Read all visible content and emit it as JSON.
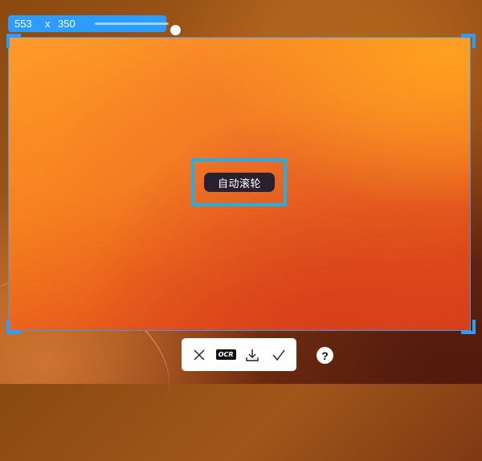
{
  "size_indicator": {
    "width": "553",
    "separator": "x",
    "height": "350"
  },
  "capture_region": {
    "auto_scroll_label": "自动滚轮"
  },
  "toolbar": {
    "ocr_label": "OCR",
    "tools": [
      "close-icon",
      "ocr-icon",
      "download-icon",
      "check-icon"
    ]
  },
  "help": {
    "label": "?"
  },
  "colors": {
    "accent": "#2d9cff",
    "highlight": "#1fb0ea",
    "button_bg": "#2a2130"
  }
}
